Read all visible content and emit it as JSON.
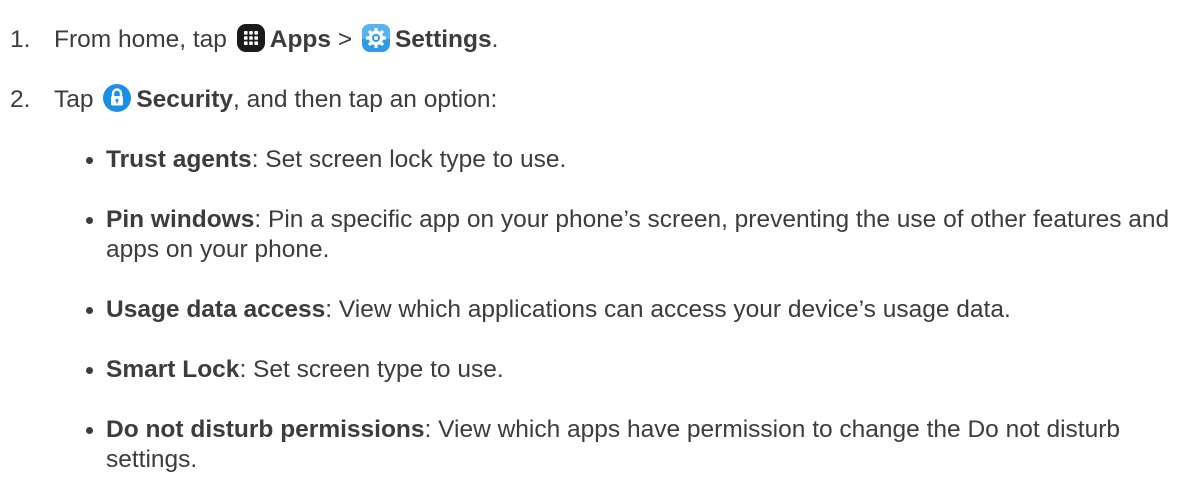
{
  "steps": [
    {
      "number": "1.",
      "prefix": "From home, tap",
      "apps_label": "Apps",
      "separator": ">",
      "settings_label": "Settings",
      "suffix": "."
    },
    {
      "number": "2.",
      "prefix": "Tap",
      "security_label": "Security",
      "suffix": ", and then tap an option:"
    }
  ],
  "options": [
    {
      "term": "Trust agents",
      "desc": ": Set screen lock type to use."
    },
    {
      "term": "Pin windows",
      "desc": ": Pin a specific app on your phone’s screen, preventing the use of other features and apps on your phone."
    },
    {
      "term": "Usage data access",
      "desc": ": View which applications can access your device’s usage data."
    },
    {
      "term": "Smart Lock",
      "desc": ": Set screen type to use."
    },
    {
      "term": "Do not disturb permissions",
      "desc": ": View which apps have permission to change the Do not disturb settings."
    }
  ],
  "icons": {
    "apps": "apps-grid-icon",
    "settings": "settings-gear-icon",
    "security": "lock-icon"
  },
  "colors": {
    "text": "#3c3c3c",
    "apps_icon_bg": "#1b1b1b",
    "settings_icon_bg": "#2e9be6",
    "security_icon_bg": "#1a8fe8"
  }
}
